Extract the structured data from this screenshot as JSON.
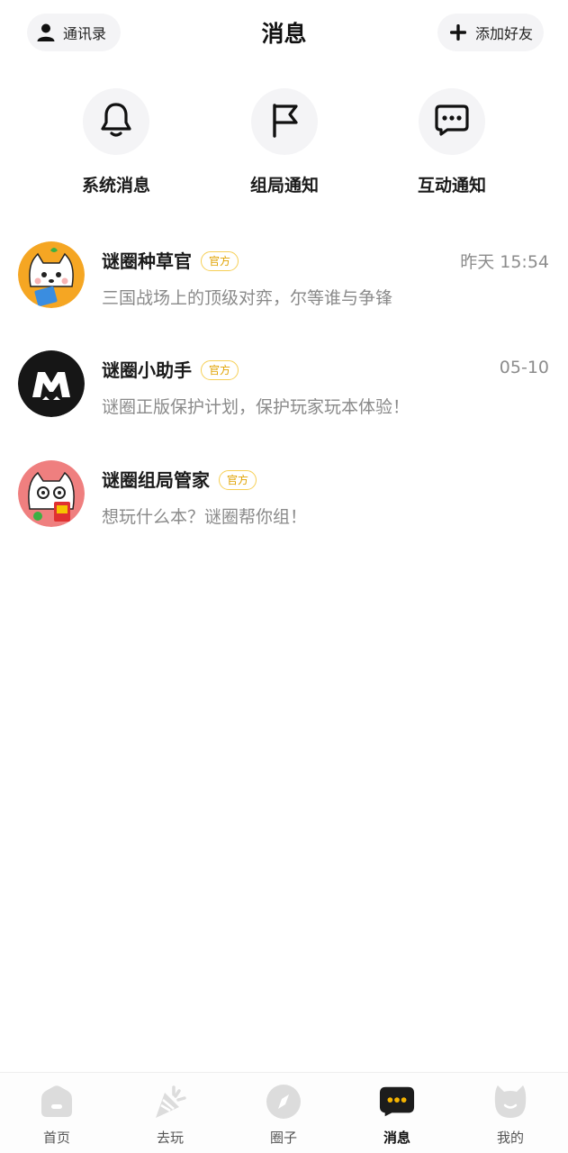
{
  "header": {
    "title": "消息",
    "contacts_label": "通讯录",
    "add_friend_label": "添加好友"
  },
  "quick_actions": [
    {
      "label": "系统消息",
      "icon": "bell-icon"
    },
    {
      "label": "组局通知",
      "icon": "flag-icon"
    },
    {
      "label": "互动通知",
      "icon": "chat-bubble-icon"
    }
  ],
  "conversations": [
    {
      "name": "谜圈种草官",
      "badge": "官方",
      "time": "昨天 15:54",
      "preview": "三国战场上的顶级对弈，尔等谁与争锋",
      "avatar": "cat-mascot-orange"
    },
    {
      "name": "谜圈小助手",
      "badge": "官方",
      "time": "05-10",
      "preview": "谜圈正版保护计划，保护玩家玩本体验！",
      "avatar": "m-logo-black"
    },
    {
      "name": "谜圈组局管家",
      "badge": "官方",
      "time": "",
      "preview": "想玩什么本？谜圈帮你组！",
      "avatar": "cat-mascot-red"
    }
  ],
  "tabbar": {
    "items": [
      {
        "label": "首页",
        "icon": "home-icon"
      },
      {
        "label": "去玩",
        "icon": "party-popper-icon"
      },
      {
        "label": "圈子",
        "icon": "compass-icon"
      },
      {
        "label": "消息",
        "icon": "message-icon"
      },
      {
        "label": "我的",
        "icon": "cat-face-icon"
      }
    ],
    "active": "消息"
  },
  "colors": {
    "accent_yellow": "#f6b400",
    "badge_border": "#f6cf55",
    "badge_text": "#e0a200",
    "inactive_icon": "#dcdcdc"
  }
}
